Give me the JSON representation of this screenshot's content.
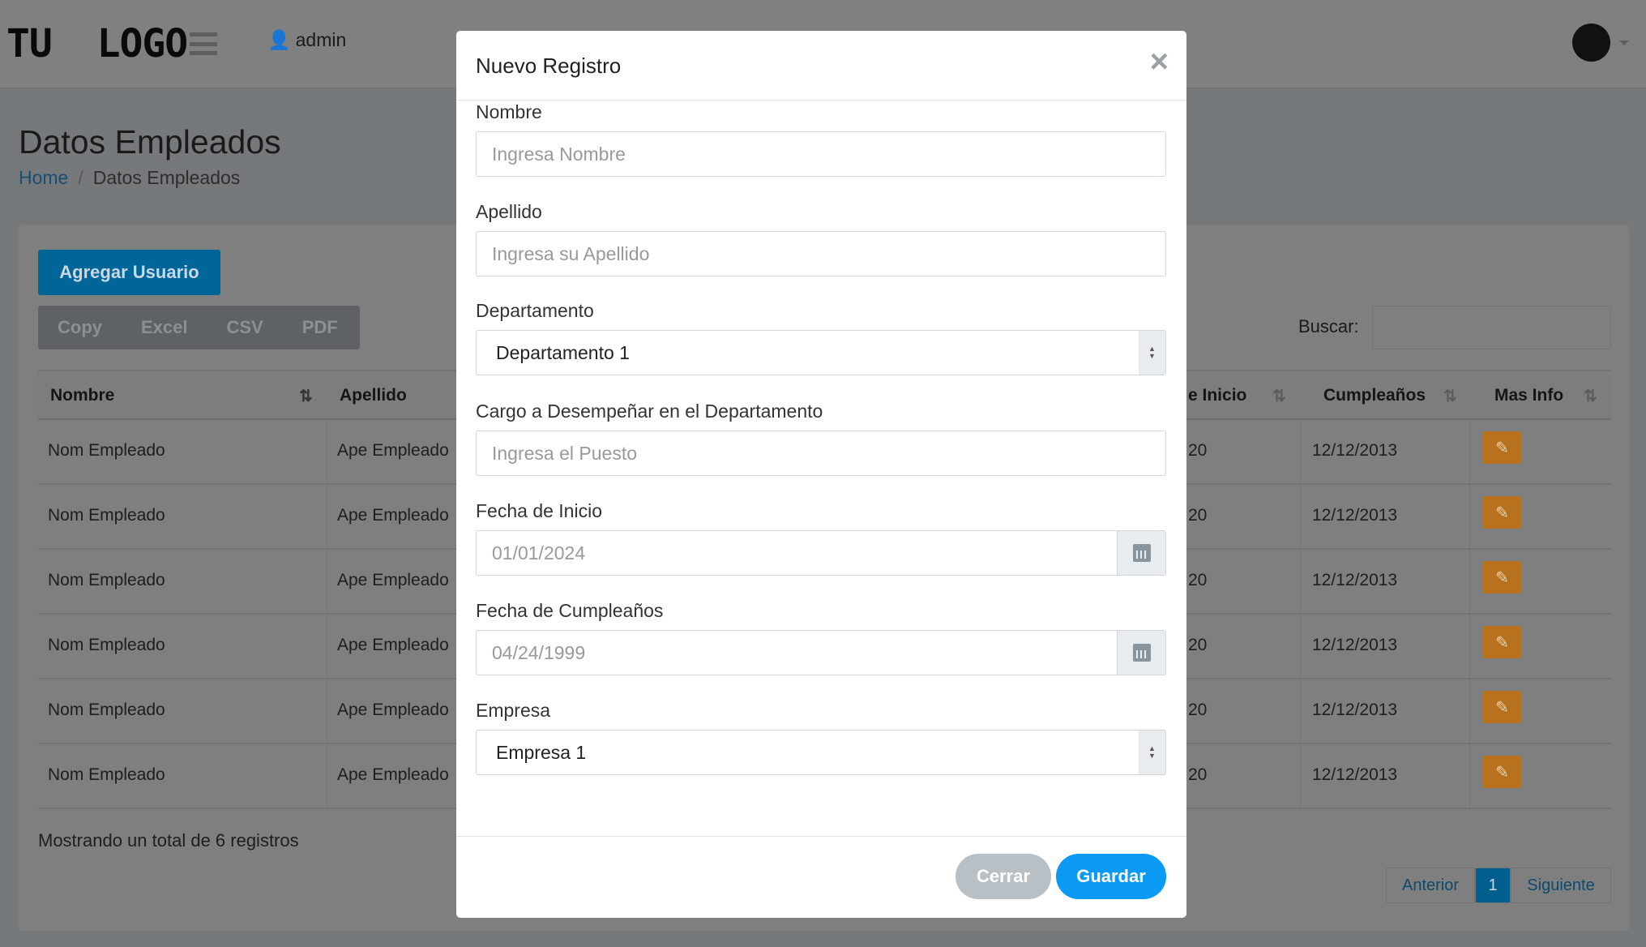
{
  "header": {
    "logo": "TU  LOGO",
    "user": "admin"
  },
  "page": {
    "title": "Datos Empleados",
    "breadcrumb": {
      "home": "Home",
      "current": "Datos Empleados"
    }
  },
  "toolbar": {
    "add_label": "Agregar Usuario",
    "export": [
      "Copy",
      "Excel",
      "CSV",
      "PDF"
    ],
    "search_label": "Buscar:",
    "search_value": ""
  },
  "table": {
    "headers": {
      "nombre": "Nombre",
      "apellido": "Apellido",
      "inicio": "e Inicio",
      "cumple": "Cumpleaños",
      "info": "Mas Info"
    },
    "rows": [
      {
        "nombre": "Nom Empleado",
        "apellido": "Ape Empleado",
        "inicio": "20",
        "cumple": "12/12/2013"
      },
      {
        "nombre": "Nom Empleado",
        "apellido": "Ape Empleado",
        "inicio": "20",
        "cumple": "12/12/2013"
      },
      {
        "nombre": "Nom Empleado",
        "apellido": "Ape Empleado",
        "inicio": "20",
        "cumple": "12/12/2013"
      },
      {
        "nombre": "Nom Empleado",
        "apellido": "Ape Empleado",
        "inicio": "20",
        "cumple": "12/12/2013"
      },
      {
        "nombre": "Nom Empleado",
        "apellido": "Ape Empleado",
        "inicio": "20",
        "cumple": "12/12/2013"
      },
      {
        "nombre": "Nom Empleado",
        "apellido": "Ape Empleado",
        "inicio": "20",
        "cumple": "12/12/2013"
      }
    ]
  },
  "footer": {
    "summary": "Mostrando un total de 6 registros",
    "prev": "Anterior",
    "page": "1",
    "next": "Siguiente"
  },
  "modal": {
    "title": "Nuevo Registro",
    "close": "×",
    "fields": [
      {
        "label": "Nombre",
        "placeholder": "Ingresa Nombre"
      },
      {
        "label": "Apellido",
        "placeholder": "Ingresa su Apellido"
      },
      {
        "label": "Departamento",
        "value": "Departamento 1"
      },
      {
        "label": "Cargo a Desempeñar en el Departamento",
        "placeholder": "Ingresa el Puesto"
      },
      {
        "label": "Fecha de Inicio",
        "placeholder": "01/01/2024"
      },
      {
        "label": "Fecha de Cumpleaños",
        "placeholder": "04/24/1999"
      },
      {
        "label": "Empresa",
        "value": "Empresa 1"
      }
    ],
    "cancel": "Cerrar",
    "save": "Guardar"
  },
  "colors": {
    "primary": "#0a9af3",
    "edit": "#b8721d",
    "add": "#006699"
  }
}
